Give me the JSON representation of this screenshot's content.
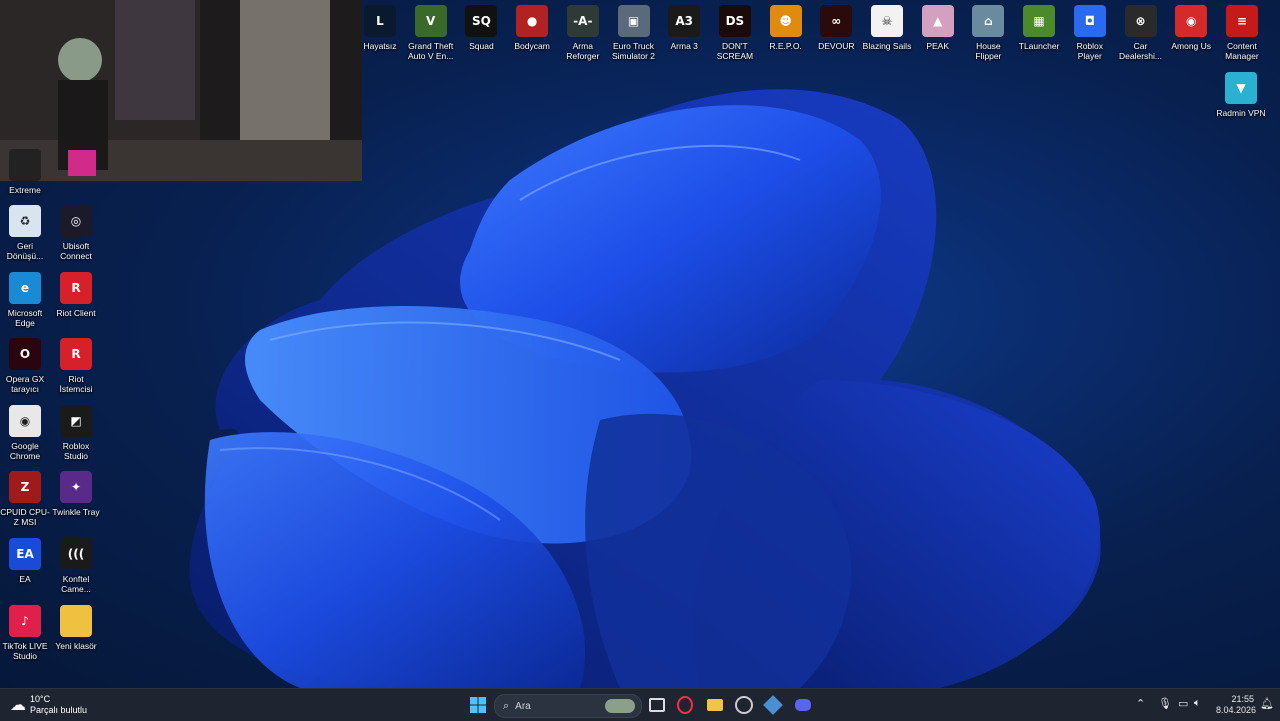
{
  "top_icons": [
    {
      "label": "Hayatsız",
      "icon": "league-of-legends-icon",
      "color": "#0a1a2e",
      "glyph": "L"
    },
    {
      "label": "Grand Theft Auto V En...",
      "icon": "gta-v-icon",
      "color": "#3a6a2a",
      "glyph": "V"
    },
    {
      "label": "Squad",
      "icon": "squad-icon",
      "color": "#111111",
      "glyph": "SQ"
    },
    {
      "label": "Bodycam",
      "icon": "bodycam-icon",
      "color": "#b22222",
      "glyph": "●"
    },
    {
      "label": "Arma Reforger",
      "icon": "arma-reforger-icon",
      "color": "#2d3a36",
      "glyph": "-A-"
    },
    {
      "label": "Euro Truck Simulator 2",
      "icon": "euro-truck-icon",
      "color": "#5a6a7a",
      "glyph": "▣"
    },
    {
      "label": "Arma 3",
      "icon": "arma-3-icon",
      "color": "#1a1a1a",
      "glyph": "A3"
    },
    {
      "label": "DON'T SCREAM",
      "icon": "dont-scream-icon",
      "color": "#1a0a0a",
      "glyph": "DS"
    },
    {
      "label": "R.E.P.O.",
      "icon": "repo-icon",
      "color": "#e08a10",
      "glyph": "☻"
    },
    {
      "label": "DEVOUR",
      "icon": "devour-icon",
      "color": "#2a0a0a",
      "glyph": "∞"
    },
    {
      "label": "Blazing Sails",
      "icon": "blazing-sails-icon",
      "color": "#f2f2f2",
      "glyph": "☠"
    },
    {
      "label": "PEAK",
      "icon": "peak-icon",
      "color": "#d4a0c0",
      "glyph": "▲"
    },
    {
      "label": "House Flipper",
      "icon": "house-flipper-icon",
      "color": "#6a8aa0",
      "glyph": "⌂"
    },
    {
      "label": "TLauncher",
      "icon": "tlauncher-icon",
      "color": "#4a8a2a",
      "glyph": "▦"
    },
    {
      "label": "Roblox Player",
      "icon": "roblox-player-icon",
      "color": "#2a6af0",
      "glyph": "◘"
    },
    {
      "label": "Car Dealershi...",
      "icon": "car-dealership-icon",
      "color": "#2a2a2a",
      "glyph": "⊗"
    },
    {
      "label": "Among Us",
      "icon": "among-us-icon",
      "color": "#d42a2a",
      "glyph": "◉"
    },
    {
      "label": "Content Manager",
      "icon": "content-manager-icon",
      "color": "#c41a1a",
      "glyph": "≡"
    }
  ],
  "right_icons": [
    {
      "label": "Radmin VPN",
      "icon": "radmin-vpn-icon",
      "color": "#2ab0d0",
      "glyph": "▼"
    }
  ],
  "left_icons_col1": [
    {
      "label": "Extreme",
      "icon": "extreme-icon",
      "color": "#222222",
      "glyph": ""
    },
    {
      "label": "Geri Dönüşü...",
      "icon": "recycle-bin-icon",
      "color": "#d8e4ee",
      "glyph": "♻"
    },
    {
      "label": "Microsoft Edge",
      "icon": "microsoft-edge-icon",
      "color": "#1a8ad4",
      "glyph": "e"
    },
    {
      "label": "Opera GX tarayıcı",
      "icon": "opera-gx-icon",
      "color": "#2a0510",
      "glyph": "O"
    },
    {
      "label": "Google Chrome",
      "icon": "google-chrome-icon",
      "color": "#e8e8e8",
      "glyph": "◉"
    },
    {
      "label": "CPUID CPU-Z MSI",
      "icon": "cpuz-icon",
      "color": "#a01a1a",
      "glyph": "Z"
    },
    {
      "label": "EA",
      "icon": "ea-icon",
      "color": "#1a4ad8",
      "glyph": "EA"
    },
    {
      "label": "TikTok LIVE Studio",
      "icon": "tiktok-live-icon",
      "color": "#e0204a",
      "glyph": "♪"
    }
  ],
  "left_icons_col2": [
    {
      "label": "Ubisoft Connect",
      "icon": "ubisoft-connect-icon",
      "color": "#1a1a2a",
      "glyph": "◎"
    },
    {
      "label": "Riot Client",
      "icon": "riot-client-icon",
      "color": "#d6202a",
      "glyph": "R"
    },
    {
      "label": "Riot İstemcisi",
      "icon": "riot-istemcisi-icon",
      "color": "#d6202a",
      "glyph": "R"
    },
    {
      "label": "Roblox Studio",
      "icon": "roblox-studio-icon",
      "color": "#1a1a1a",
      "glyph": "◩"
    },
    {
      "label": "Twinkle Tray",
      "icon": "twinkle-tray-icon",
      "color": "#5a2a8a",
      "glyph": "✦"
    },
    {
      "label": "Konftel Came...",
      "icon": "konftel-camera-icon",
      "color": "#1a1a1a",
      "glyph": "((("
    },
    {
      "label": "Yeni klasör",
      "icon": "folder-icon",
      "color": "#f0c040",
      "glyph": ""
    }
  ],
  "taskbar": {
    "weather_temp": "10°C",
    "weather_desc": "Parçalı bulutlu",
    "search_placeholder": "Ara",
    "time": "21:55",
    "date": "8.04.2026"
  },
  "colors": {
    "taskbar_bg": "#1f2530",
    "accent": "#2a6af0"
  }
}
